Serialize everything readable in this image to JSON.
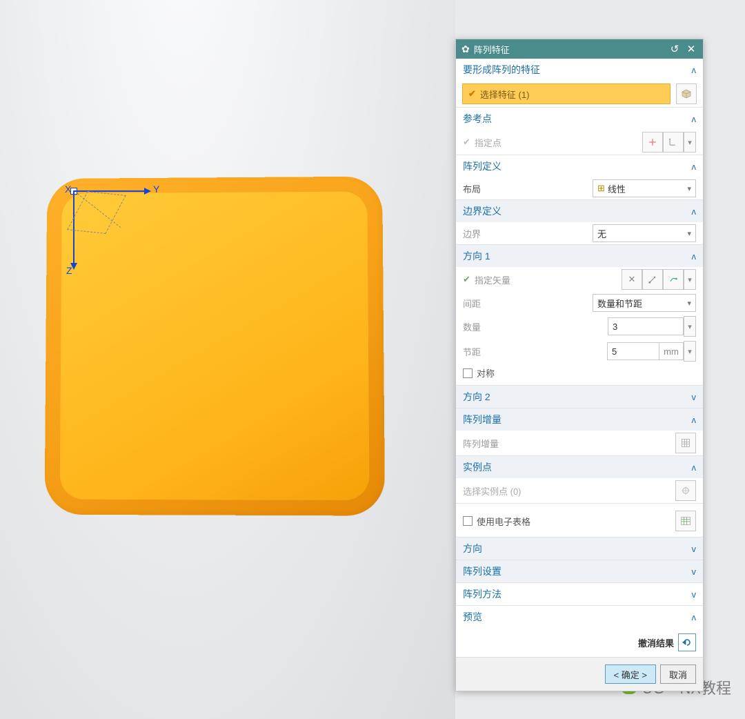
{
  "viewport": {
    "axes": {
      "x": "X",
      "y": "Y",
      "z": "Z"
    },
    "watermark": "UG—NX教程"
  },
  "panel": {
    "title": "阵列特征",
    "sections": {
      "featuresToPattern": {
        "title": "要形成阵列的特征",
        "selectRow": "选择特征 (1)"
      },
      "refPoint": {
        "title": "参考点",
        "specifyPoint": "指定点"
      },
      "patternDef": {
        "title": "阵列定义",
        "layout": {
          "label": "布局",
          "value": "线性"
        },
        "boundaryDef": {
          "title": "边界定义",
          "boundaryLabel": "边界",
          "boundaryValue": "无"
        },
        "direction1": {
          "title": "方向 1",
          "specifyVector": "指定矢量",
          "spacing": {
            "label": "间距",
            "value": "数量和节距"
          },
          "count": {
            "label": "数量",
            "value": "3"
          },
          "pitch": {
            "label": "节距",
            "value": "5",
            "unit": "mm"
          },
          "symmetric": "对称"
        },
        "direction2": {
          "title": "方向 2"
        },
        "patternIncrement": {
          "title": "阵列增量",
          "label": "阵列增量"
        },
        "instancePoints": {
          "title": "实例点",
          "selectLabel": "选择实例点 (0)"
        },
        "useSpreadsheet": "使用电子表格",
        "orientation": {
          "title": "方向"
        },
        "patternSettings": {
          "title": "阵列设置"
        }
      },
      "patternMethod": {
        "title": "阵列方法"
      },
      "preview": {
        "title": "预览",
        "undoResult": "撤消结果"
      }
    },
    "footer": {
      "ok": "< 确定 >",
      "cancel": "取消"
    }
  }
}
